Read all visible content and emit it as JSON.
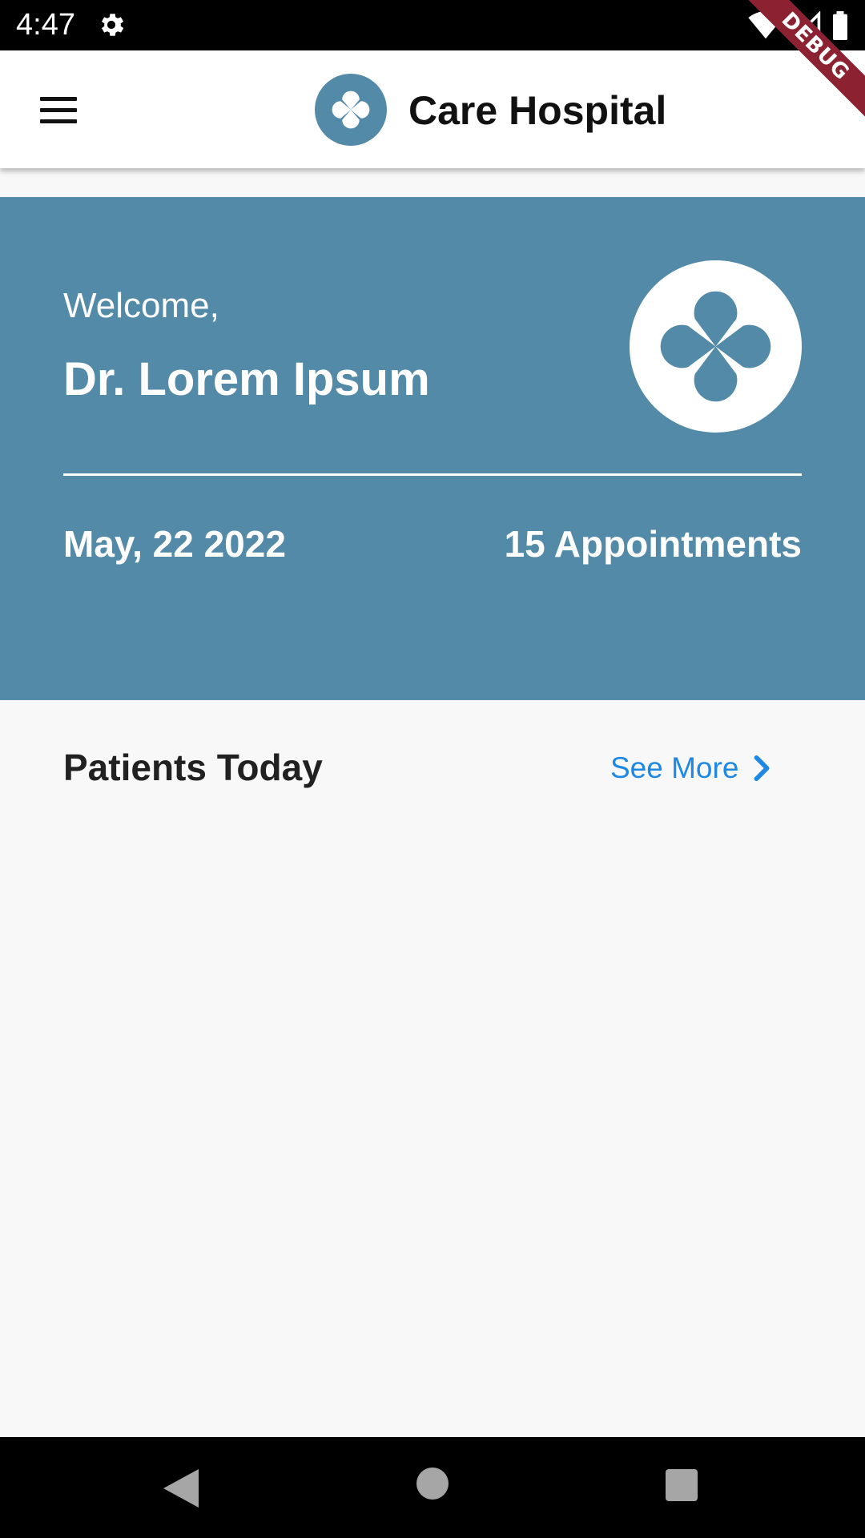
{
  "status_bar": {
    "time": "4:47",
    "icons": [
      "settings-icon",
      "wifi-icon",
      "signal-icon",
      "battery-icon"
    ]
  },
  "debug_banner": {
    "label": "DEBUG"
  },
  "app_bar": {
    "title": "Care Hospital",
    "menu_icon": "hamburger-menu-icon",
    "logo_icon": "clover-logo-icon"
  },
  "welcome_card": {
    "greeting": "Welcome,",
    "doctor_name": "Dr. Lorem Ipsum",
    "date": "May, 22 2022",
    "appointments": "15 Appointments",
    "logo_icon": "clover-logo-icon"
  },
  "patients_section": {
    "title": "Patients Today",
    "see_more_label": "See More",
    "see_more_icon": "chevron-right-icon"
  },
  "nav_bar": {
    "icons": [
      "back-icon",
      "home-icon",
      "recents-icon"
    ]
  },
  "colors": {
    "primary": "#528aa8",
    "link": "#1e88e5",
    "background": "#f8f8f8",
    "debug_ribbon": "#8b2131"
  }
}
